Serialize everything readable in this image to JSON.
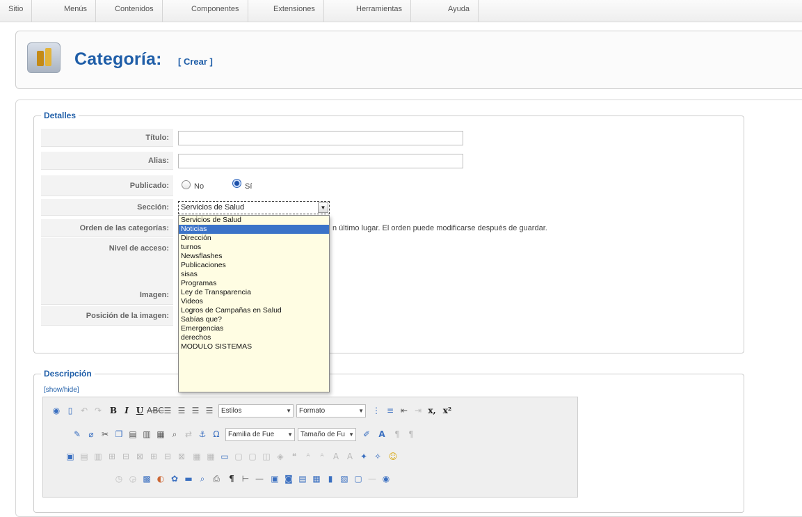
{
  "menu": [
    "Sitio",
    "Menús",
    "Contenidos",
    "Componentes",
    "Extensiones",
    "Herramientas",
    "Ayuda"
  ],
  "header": {
    "title": "Categoría:",
    "subtitle": "[ Crear ]",
    "icon": "category-icon"
  },
  "details": {
    "legend": "Detalles",
    "fields": {
      "title_label": "Título:",
      "alias_label": "Alias:",
      "published_label": "Publicado:",
      "published_no": "No",
      "published_yes": "Sí",
      "section_label": "Sección:",
      "order_label": "Orden de las categorías:",
      "order_note": "n último lugar. El orden puede modificarse después de guardar.",
      "access_label": "Nivel de acceso:",
      "image_label": "Imagen:",
      "image_position_label": "Posición de la imagen:"
    },
    "title_value": "",
    "alias_value": "",
    "published": "Sí",
    "section_selected": "Servicios de Salud",
    "section_options": [
      "Servicios de Salud",
      "Noticias",
      "Dirección",
      "turnos",
      "Newsflashes",
      "Publicaciones",
      "sisas",
      "Programas",
      "Ley de Transparencia",
      "Videos",
      "Logros de Campañas en Salud",
      "Sabías que?",
      "Emergencias",
      "derechos",
      "MODULO SISTEMAS"
    ],
    "highlighted_option": "Noticias"
  },
  "description": {
    "legend": "Descripción",
    "toggle": "[show/hide]",
    "toolbar": {
      "styles": "Estilos",
      "format": "Formato",
      "font_family": "Familia de Fue",
      "font_size": "Tamaño de Fu"
    }
  }
}
